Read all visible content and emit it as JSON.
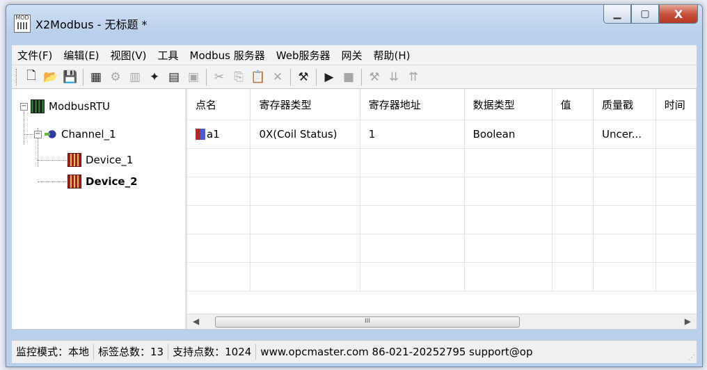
{
  "window": {
    "title": "X2Modbus - 无标题 *",
    "icon_text": "MOD",
    "min_icon": "▁",
    "max_icon": "▢",
    "close_icon": "X"
  },
  "menu": [
    "文件(F)",
    "编辑(E)",
    "视图(V)",
    "工具",
    "Modbus 服务器",
    "Web服务器",
    "网关",
    "帮助(H)"
  ],
  "toolbar": [
    {
      "name": "new-file-icon",
      "glyph": "🗋",
      "disabled": false
    },
    {
      "name": "open-folder-icon",
      "glyph": "📂",
      "disabled": false
    },
    {
      "name": "save-icon",
      "glyph": "💾",
      "disabled": false
    },
    {
      "sep": true
    },
    {
      "name": "add-server-icon",
      "glyph": "▦",
      "disabled": false
    },
    {
      "name": "add-channel-icon",
      "glyph": "⚙",
      "disabled": true
    },
    {
      "name": "add-device-icon",
      "glyph": "▥",
      "disabled": true
    },
    {
      "name": "new-tag-icon",
      "glyph": "✦",
      "disabled": false
    },
    {
      "name": "add-tag-icon",
      "glyph": "▤",
      "disabled": false
    },
    {
      "name": "properties-icon",
      "glyph": "▣",
      "disabled": true
    },
    {
      "sep": true
    },
    {
      "name": "cut-icon",
      "glyph": "✂",
      "disabled": true
    },
    {
      "name": "copy-icon",
      "glyph": "⎘",
      "disabled": true
    },
    {
      "name": "paste-icon",
      "glyph": "📋",
      "disabled": true
    },
    {
      "name": "delete-icon",
      "glyph": "✕",
      "disabled": true
    },
    {
      "sep": true
    },
    {
      "name": "monitor-icon",
      "glyph": "⚒",
      "disabled": false
    },
    {
      "sep": true
    },
    {
      "name": "run-icon",
      "glyph": "▶",
      "disabled": false
    },
    {
      "name": "stop-icon",
      "glyph": "■",
      "disabled": true
    },
    {
      "sep": true
    },
    {
      "name": "tools-icon",
      "glyph": "⚒",
      "disabled": true
    },
    {
      "name": "load-icon",
      "glyph": "⇊",
      "disabled": true
    },
    {
      "name": "upload-icon",
      "glyph": "⇈",
      "disabled": true
    }
  ],
  "tree": {
    "root": "ModbusRTU",
    "channel": "Channel_1",
    "devices": [
      "Device_1",
      "Device_2"
    ],
    "selected": "Device_2"
  },
  "table": {
    "headers": [
      "点名",
      "寄存器类型",
      "寄存器地址",
      "数据类型",
      "值",
      "质量戳",
      "时间"
    ],
    "rows": [
      [
        "a1",
        "0X(Coil Status)",
        "1",
        "Boolean",
        "",
        "Uncer...",
        ""
      ]
    ],
    "empty_rows": 5,
    "scroll_thumb": "III"
  },
  "status": [
    "监控模式：本地",
    "标签总数：13",
    "支持点数：1024",
    "www.opcmaster.com 86-021-20252795 support@op"
  ]
}
